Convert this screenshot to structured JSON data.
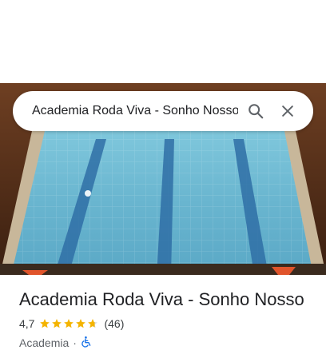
{
  "search": {
    "query": "Academia Roda Viva - Sonho Nosso",
    "search_icon": "search-icon",
    "close_icon": "close-icon"
  },
  "hero": {
    "image": "indoor-swimming-pool-photo"
  },
  "place": {
    "name": "Academia Roda Viva - Sonho Nosso",
    "rating": "4,7",
    "rating_value": 4.7,
    "star_icon": "star-icon",
    "review_count": "(46)",
    "category": "Academia",
    "separator": "·",
    "accessibility_icon": "wheelchair-icon"
  },
  "colors": {
    "star": "#F4B400",
    "accessibility": "#1A73E8",
    "icon_gray": "#5F6368",
    "text_primary": "#202124"
  }
}
